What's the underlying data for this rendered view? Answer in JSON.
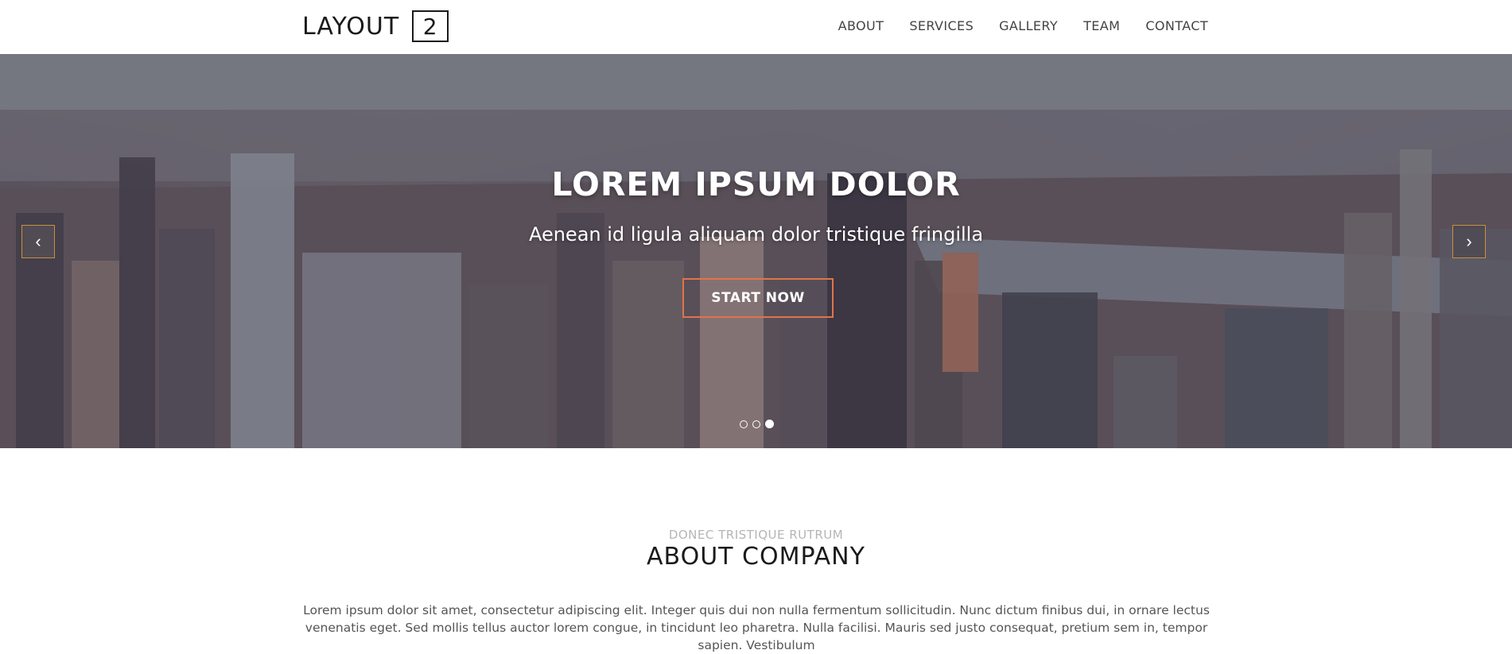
{
  "header": {
    "logo_text": "LAYOUT",
    "logo_number": "2",
    "nav": [
      "ABOUT",
      "SERVICES",
      "GALLERY",
      "TEAM",
      "CONTACT"
    ]
  },
  "hero": {
    "title": "LOREM IPSUM DOLOR",
    "subtitle": "Aenean id ligula aliquam dolor tristique fringilla",
    "button_label": "START NOW",
    "prev_icon": "chevron-left-icon",
    "next_icon": "chevron-right-icon",
    "slide_count": 3,
    "active_slide": 3,
    "accent_color": "#e2734a"
  },
  "about": {
    "eyebrow": "DONEC TRISTIQUE RUTRUM",
    "title": "ABOUT COMPANY",
    "body": "Lorem ipsum dolor sit amet, consectetur adipiscing elit. Integer quis dui non nulla fermentum sollicitudin. Nunc dictum finibus dui, in ornare lectus venenatis eget. Sed mollis tellus auctor lorem congue, in tincidunt leo pharetra. Nulla facilisi. Mauris sed justo consequat, pretium sem in, tempor sapien. Vestibulum"
  }
}
